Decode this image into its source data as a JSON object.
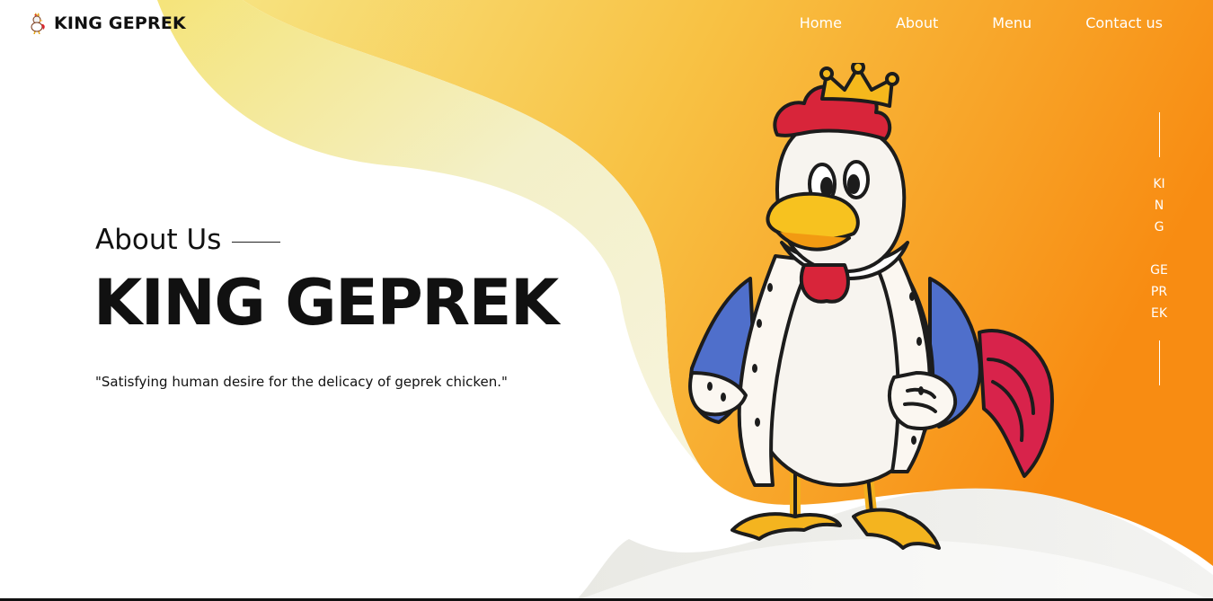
{
  "header": {
    "brand_name": "KING GEPREK",
    "logo_icon": "rooster-logo-icon",
    "nav": [
      {
        "label": "Home"
      },
      {
        "label": "About"
      },
      {
        "label": "Menu"
      },
      {
        "label": "Contact us"
      }
    ]
  },
  "hero": {
    "subtitle": "About Us",
    "title": "KING GEPREK",
    "tagline": "\"Satisfying human desire for the delicacy of geprek chicken.\""
  },
  "side_label": {
    "text": "KING\n\nGEPREK"
  },
  "mascot": {
    "icon": "crowned-rooster-mascot"
  },
  "colors": {
    "accent_orange": "#f89a1c",
    "accent_yellow": "#f6d35d",
    "text_dark": "#111111",
    "nav_text": "#ffffff"
  }
}
